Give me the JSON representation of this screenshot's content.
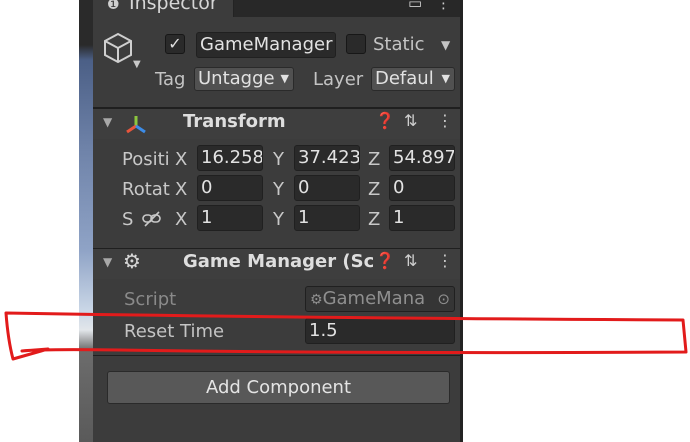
{
  "inspector": {
    "tab_title": "Inspector",
    "tab_lock_glyph": "🔒",
    "tab_maximize_glyph": "▭",
    "tab_menu_glyph": "⋮"
  },
  "gameobject": {
    "active": true,
    "name": "GameManager",
    "static_label": "Static",
    "static_checked": false,
    "tag_label": "Tag",
    "tag_value": "Untagge",
    "layer_label": "Layer",
    "layer_value": "Defaul"
  },
  "transform": {
    "title": "Transform",
    "position_label": "Positi",
    "rotation_label": "Rotati",
    "scale_label": "S",
    "axis_x": "X",
    "axis_y": "Y",
    "axis_z": "Z",
    "position": {
      "x": "16.258",
      "y": "37.423",
      "z": "54.897"
    },
    "rotation": {
      "x": "0",
      "y": "0",
      "z": "0"
    },
    "scale": {
      "x": "1",
      "y": "1",
      "z": "1"
    }
  },
  "game_manager": {
    "title": "Game Manager (Scr",
    "script_label": "Script",
    "script_value": "GameMana",
    "reset_time_label": "Reset Time",
    "reset_time_value": "1.5"
  },
  "add_component_label": "Add Component",
  "colors": {
    "panel_bg": "#3c3c3c",
    "field_bg": "#2a2a2a",
    "button_bg": "#585858",
    "annotation_red": "#e21b1b"
  },
  "icons": [
    "lock-icon",
    "maximize-icon",
    "kebab-menu-icon",
    "cube-icon",
    "transform-gizmo-icon",
    "help-icon",
    "preset-icon",
    "gear-icon",
    "link-icon",
    "object-picker-icon"
  ]
}
